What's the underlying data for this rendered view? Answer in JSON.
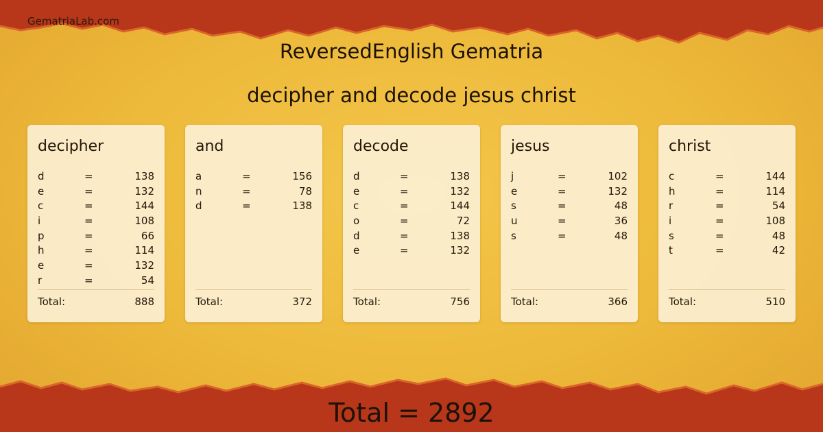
{
  "site_name": "GematriaLab.com",
  "title": "ReversedEnglish Gematria",
  "phrase": "decipher and decode jesus christ",
  "total_label": "Total:",
  "grand_total": "Total = 2892",
  "colors": {
    "top_band": "#b8371a",
    "bottom_band": "#b8371a",
    "background": "#f4c64a",
    "card": "#fcf1d6"
  },
  "words": [
    {
      "word": "decipher",
      "letters": [
        {
          "l": "d",
          "eq": "=",
          "v": "138"
        },
        {
          "l": "e",
          "eq": "=",
          "v": "132"
        },
        {
          "l": "c",
          "eq": "=",
          "v": "144"
        },
        {
          "l": "i",
          "eq": "=",
          "v": "108"
        },
        {
          "l": "p",
          "eq": "=",
          "v": "66"
        },
        {
          "l": "h",
          "eq": "=",
          "v": "114"
        },
        {
          "l": "e",
          "eq": "=",
          "v": "132"
        },
        {
          "l": "r",
          "eq": "=",
          "v": "54"
        }
      ],
      "total": "888"
    },
    {
      "word": "and",
      "letters": [
        {
          "l": "a",
          "eq": "=",
          "v": "156"
        },
        {
          "l": "n",
          "eq": "=",
          "v": "78"
        },
        {
          "l": "d",
          "eq": "=",
          "v": "138"
        }
      ],
      "total": "372"
    },
    {
      "word": "decode",
      "letters": [
        {
          "l": "d",
          "eq": "=",
          "v": "138"
        },
        {
          "l": "e",
          "eq": "=",
          "v": "132"
        },
        {
          "l": "c",
          "eq": "=",
          "v": "144"
        },
        {
          "l": "o",
          "eq": "=",
          "v": "72"
        },
        {
          "l": "d",
          "eq": "=",
          "v": "138"
        },
        {
          "l": "e",
          "eq": "=",
          "v": "132"
        }
      ],
      "total": "756"
    },
    {
      "word": "jesus",
      "letters": [
        {
          "l": "j",
          "eq": "=",
          "v": "102"
        },
        {
          "l": "e",
          "eq": "=",
          "v": "132"
        },
        {
          "l": "s",
          "eq": "=",
          "v": "48"
        },
        {
          "l": "u",
          "eq": "=",
          "v": "36"
        },
        {
          "l": "s",
          "eq": "=",
          "v": "48"
        }
      ],
      "total": "366"
    },
    {
      "word": "christ",
      "letters": [
        {
          "l": "c",
          "eq": "=",
          "v": "144"
        },
        {
          "l": "h",
          "eq": "=",
          "v": "114"
        },
        {
          "l": "r",
          "eq": "=",
          "v": "54"
        },
        {
          "l": "i",
          "eq": "=",
          "v": "108"
        },
        {
          "l": "s",
          "eq": "=",
          "v": "48"
        },
        {
          "l": "t",
          "eq": "=",
          "v": "42"
        }
      ],
      "total": "510"
    }
  ]
}
